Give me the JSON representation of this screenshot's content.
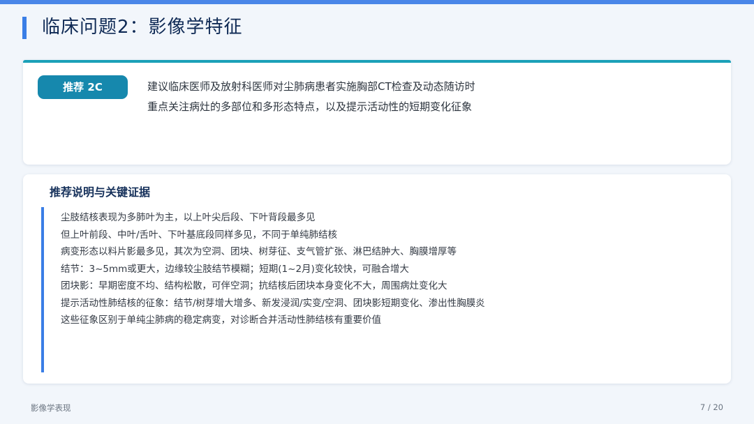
{
  "header": {
    "title": "临床问题2：影像学特征"
  },
  "recommendation": {
    "badge": "推荐 2C",
    "lines": [
      "建议临床医师及放射科医师对尘肺病患者实施胸部CT检查及动态随访时",
      "重点关注病灶的多部位和多形态特点，以及提示活动性的短期变化征象"
    ]
  },
  "explanation": {
    "heading": "推荐说明与关键证据",
    "items": [
      "尘肢结核表现为多肺叶为主，以上叶尖后段、下叶背段最多见",
      "但上叶前段、中叶/舌叶、下叶基底段同样多见，不同于单纯肺结核",
      "病变形态以料片影最多见，其次为空洞、团块、树芽征、支气管扩张、淋巴结肿大、胸膜增厚等",
      "结节：3~5mm或更大，边缘较尘肢结节模糊；短期(1~2月)变化较快，可融合增大",
      "团块影：早期密度不均、结构松散，可伴空洞；抗结核后团块本身变化不大，周围病灶变化大",
      "提示活动性肺结核的征象：结节/树芽增大增多、新发浸润/实变/空洞、团块影短期变化、渗出性胸膜炎",
      "这些征象区别于单纯尘肺病的稳定病变，对诊断合并活动性肺结核有重要价值"
    ]
  },
  "footer": {
    "section": "影像学表现",
    "page": "7 / 20"
  }
}
